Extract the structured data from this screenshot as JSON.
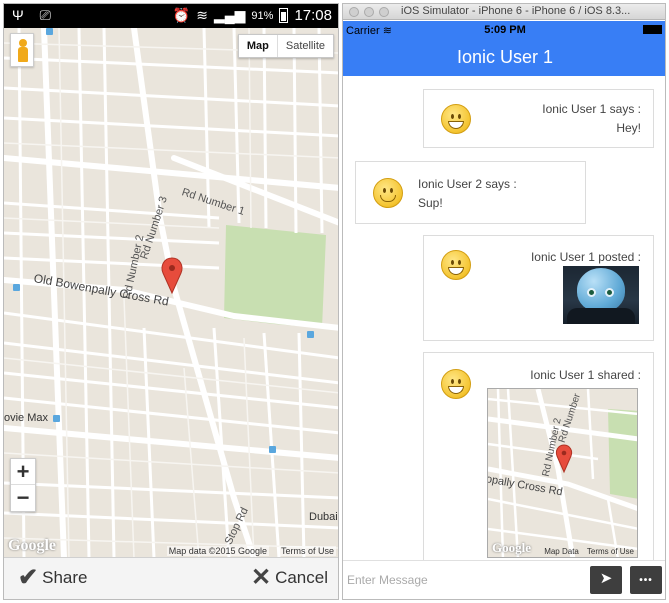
{
  "left": {
    "status_bar": {
      "left_icons": "Ψ ⎚",
      "battery_level": "91%",
      "time": "17:08"
    },
    "map": {
      "type_options": [
        "Map",
        "Satellite"
      ],
      "selected_type": "Map",
      "zoom_in": "+",
      "zoom_out": "−",
      "labels": {
        "rd1": "Rd Number 1",
        "rd2": "Rd Number 2",
        "rd3": "Rd Number 3",
        "cross": "Old Bowenpally Cross Rd",
        "stop": "Stop Rd",
        "movie": "ovie Max",
        "dubai": "Dubai"
      },
      "google": "Google",
      "attribution": "Map data ©2015 Google",
      "terms": "Terms of Use"
    },
    "actions": {
      "share": "Share",
      "cancel": "Cancel"
    }
  },
  "right": {
    "window_title": "iOS Simulator - iPhone 6 - iPhone 6 / iOS 8.3...",
    "status": {
      "carrier": "Carrier",
      "time": "5:09 PM"
    },
    "header_title": "Ionic User 1",
    "messages": [
      {
        "meta": "Ionic User 1 says :",
        "text": "Hey!"
      },
      {
        "meta": "Ionic User 2 says :",
        "text": "Sup!"
      },
      {
        "meta": "Ionic User 1 posted :"
      },
      {
        "meta": "Ionic User 1 shared :",
        "map_labels": {
          "rd1": "Rd Number",
          "rd2": "Rd Number 2",
          "cross": "opally Cross Rd"
        },
        "google": "Google",
        "attribution": "Map Data",
        "terms": "Terms of Use"
      }
    ],
    "composer": {
      "placeholder": "Enter Message",
      "send_icon": "➤",
      "more_icon": "•••"
    }
  },
  "colors": {
    "ios_blue": "#387ef5",
    "map_bg": "#eae5dc",
    "park": "#c8dfb1",
    "marker": "#e74c3c"
  }
}
